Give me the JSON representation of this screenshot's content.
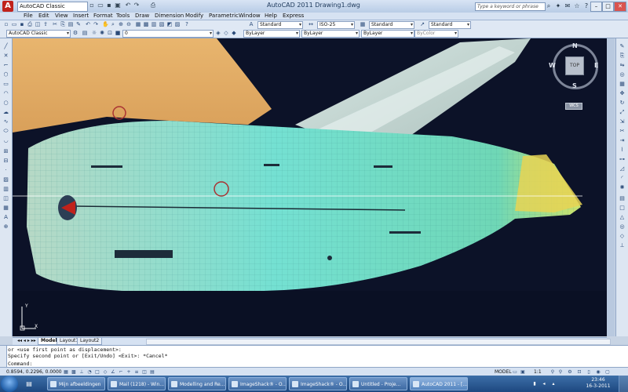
{
  "title_bar": {
    "workspace": "AutoCAD Classic",
    "window_title": "AutoCAD 2011    Drawing1.dwg",
    "help_search_placeholder": "Type a keyword or phrase"
  },
  "menu": [
    "File",
    "Edit",
    "View",
    "Insert",
    "Format",
    "Tools",
    "Draw",
    "Dimension",
    "Modify",
    "Parametric",
    "Window",
    "Help",
    "Express"
  ],
  "toolbar1": {
    "text_style": "Standard",
    "dim_style": "ISO-25",
    "table_style": "Standard",
    "multileader_style": "Standard"
  },
  "toolbar2": {
    "workspace": "AutoCAD Classic",
    "layer": "0",
    "color": "ByLayer",
    "linetype": "ByLayer",
    "lineweight": "ByLayer",
    "plotstyle": "ByColor"
  },
  "viewcube": {
    "n": "N",
    "s": "S",
    "e": "E",
    "w": "W",
    "face": "TOP",
    "wcs": "WCS"
  },
  "ucs": {
    "y": "Y",
    "x": "X"
  },
  "tabs": [
    "Model",
    "Layout1",
    "Layout2"
  ],
  "command": {
    "line1": "or <use first point as displacement>:",
    "line2": "Specify second point or [Exit/Undo] <Exit>: *Cancel*",
    "prompt": "Command:"
  },
  "status": {
    "coordinates": "0.8594, 0.2296, 0.0000",
    "model_label": "MODEL",
    "scale": "1:1"
  },
  "taskbar": {
    "items": [
      {
        "label": "Mijn afbeeldingen",
        "active": false
      },
      {
        "label": "Mail (1218) - Win...",
        "active": false
      },
      {
        "label": "Modelling and Re...",
        "active": false
      },
      {
        "label": "ImageShack® - O...",
        "active": false
      },
      {
        "label": "ImageShack® - O...",
        "active": false
      },
      {
        "label": "Untitled - Proje...",
        "active": false
      },
      {
        "label": "AutoCAD 2011 - [...",
        "active": true
      }
    ],
    "time": "23:46",
    "date": "16-3-2011"
  },
  "colors": {
    "canvas": "#0c1228",
    "hull_overlay": "#6fe0c8",
    "hull_accent": "#ffd24a",
    "selection": "#c0221b"
  },
  "icons": {
    "app_logo": "autocad-logo",
    "start": "windows-start-orb"
  }
}
